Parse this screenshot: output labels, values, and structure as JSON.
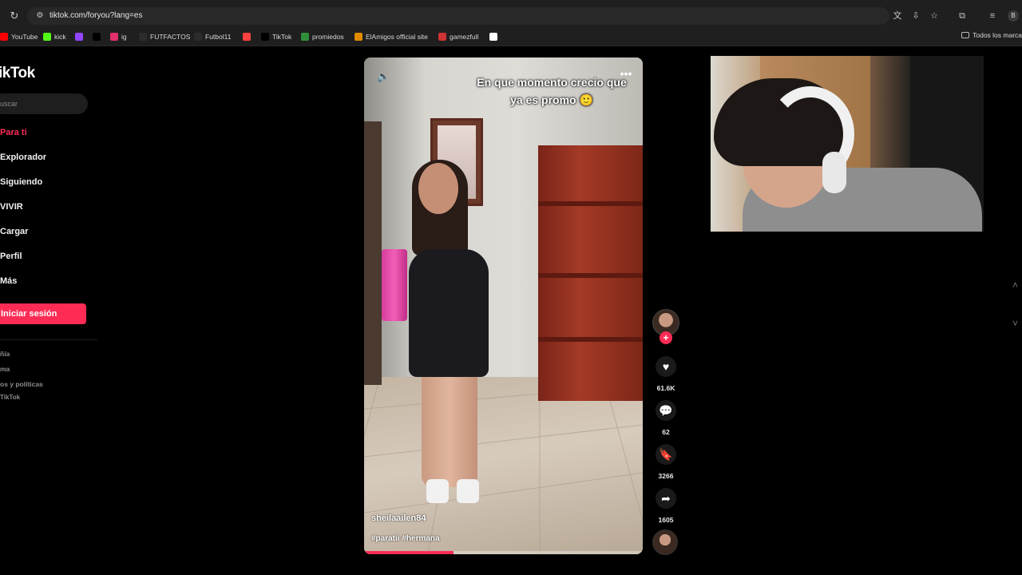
{
  "browser": {
    "url": "tiktok.com/foryou?lang=es",
    "profile_initial": "B",
    "bookmarks": [
      {
        "label": "YouTube",
        "icon": "youtube-icon",
        "color": "#ff0000"
      },
      {
        "label": "kick",
        "icon": "kick-icon",
        "color": "#53fc18"
      },
      {
        "label": "",
        "icon": "twitch-icon",
        "color": "#9146ff"
      },
      {
        "label": "",
        "icon": "x-icon",
        "color": "#000000"
      },
      {
        "label": "ig",
        "icon": "instagram-icon",
        "color": "#e1306c"
      },
      {
        "label": "FUTFACTOS",
        "icon": "futfactos-icon",
        "color": "#2c2c2c"
      },
      {
        "label": "Futbol11",
        "icon": "futbol11-icon",
        "color": "#2c2c2c"
      },
      {
        "label": "",
        "icon": "youtube-small-icon",
        "color": "#ff4040"
      },
      {
        "label": "TikTok",
        "icon": "tiktok-icon",
        "color": "#000000"
      },
      {
        "label": "promiedos",
        "icon": "promiedos-icon",
        "color": "#2f8f3a"
      },
      {
        "label": "ElAmigos official site",
        "icon": "elamigos-icon",
        "color": "#e08a00"
      },
      {
        "label": "gamezfull",
        "icon": "gamezfull-icon",
        "color": "#cc3333"
      },
      {
        "label": "",
        "icon": "diamond-icon",
        "color": "#ffffff"
      }
    ],
    "bookmarks_right": "Todos los marca"
  },
  "sidebar": {
    "logo": "ikTok",
    "search_placeholder": "uscar",
    "nav": [
      "Para ti",
      "Explorador",
      "Siguiendo",
      "VIVIR",
      "Cargar",
      "Perfil",
      "Más"
    ],
    "login_label": "Iniciar sesión",
    "footer_links": [
      "ñía",
      "ma",
      "os y políticas",
      "TikTok"
    ]
  },
  "video": {
    "caption_overlay": "En que momento crecio que ya es promo 🙂",
    "author": "sheilaailen84",
    "tags": "#paratii #hermana",
    "progress": 0.32
  },
  "actions": {
    "likes": "61.6K",
    "comments": "62",
    "saves": "3266",
    "shares": "1605"
  },
  "colors": {
    "accent": "#fe2c55",
    "background": "#000000"
  }
}
